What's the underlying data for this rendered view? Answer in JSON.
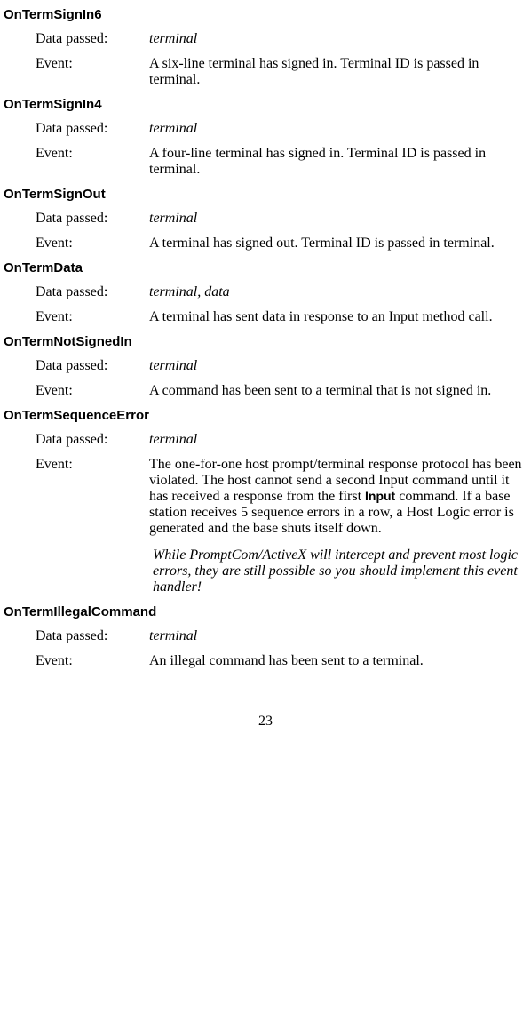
{
  "labels": {
    "data_passed": "Data passed:",
    "event": "Event:"
  },
  "sections": [
    {
      "title": "OnTermSignIn6",
      "data_passed": "terminal",
      "event": "A six-line terminal has signed in. Terminal ID is passed in terminal."
    },
    {
      "title": "OnTermSignIn4",
      "data_passed": "terminal",
      "event": "A four-line terminal has signed in. Terminal ID is passed in terminal."
    },
    {
      "title": "OnTermSignOut",
      "data_passed": "terminal",
      "event": "A terminal has signed out. Terminal ID is passed in terminal."
    },
    {
      "title": "OnTermData",
      "data_passed": "terminal, data",
      "event": "A terminal has sent data in response to an Input method call."
    },
    {
      "title": "OnTermNotSignedIn",
      "data_passed": "terminal",
      "event": "A command has been sent to a terminal that is not signed in."
    },
    {
      "title": "OnTermSequenceError",
      "data_passed": "terminal",
      "event_pre": "The one-for-one host prompt/terminal response protocol has been violated. The host cannot send a second Input command until it has received a response from the first ",
      "event_bold": "Input",
      "event_post": " command. If a base station receives 5 sequence errors in a row, a Host Logic error is generated and the base shuts itself down.",
      "note": "While PromptCom/ActiveX will intercept and prevent most logic errors, they are still possible so you should implement this event handler!"
    },
    {
      "title": "OnTermIllegalCommand",
      "data_passed": "terminal",
      "event": "An illegal command has been sent to a terminal."
    }
  ],
  "page_number": "23"
}
